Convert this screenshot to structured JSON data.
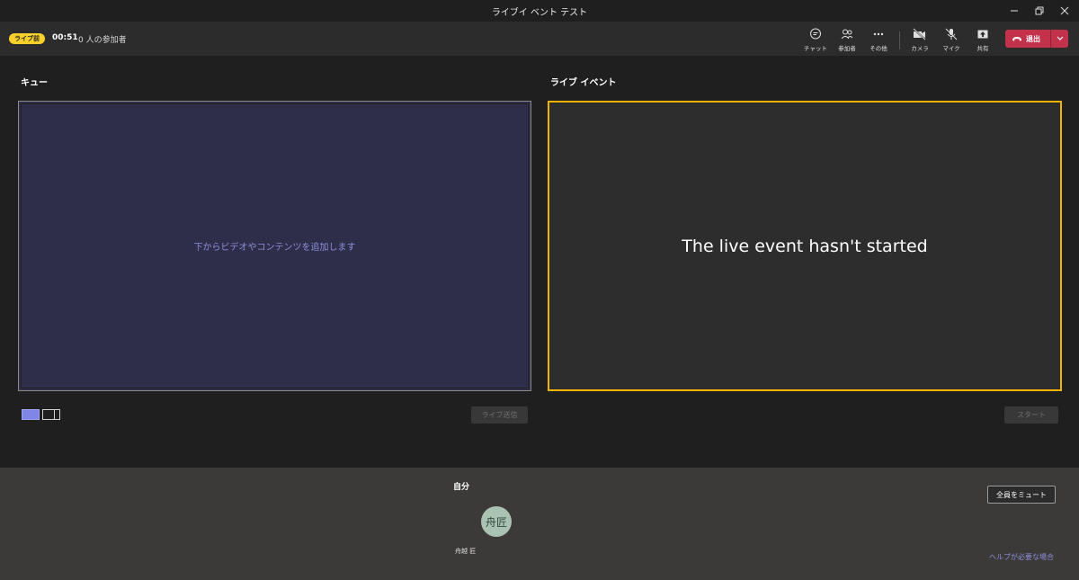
{
  "window": {
    "title": "ライブイ ベント テスト"
  },
  "toolbar": {
    "status_badge": "ライブ前",
    "elapsed": "00:51",
    "attendee_count": "0 人の参加者",
    "buttons": {
      "chat": "チャット",
      "participants": "参加者",
      "more": "その他",
      "camera": "カメラ",
      "mic": "マイク",
      "share": "共有"
    },
    "leave_label": "退出",
    "leave_color": "#c4314b",
    "status_color": "#f8d22a"
  },
  "queue": {
    "title": "キュー",
    "hint": "下からビデオやコンテンツを追加します",
    "send_live": "ライブ送信"
  },
  "live_event": {
    "title": "ライブ イベント",
    "message": "The live event hasn't started",
    "start": "スタート",
    "border_color": "#f0b400"
  },
  "participants_panel": {
    "me_label": "自分",
    "avatar_initials": "舟匠",
    "avatar_name": "舟越 匠",
    "mute_all": "全員をミュート",
    "help": "ヘルプが必要な場合"
  }
}
